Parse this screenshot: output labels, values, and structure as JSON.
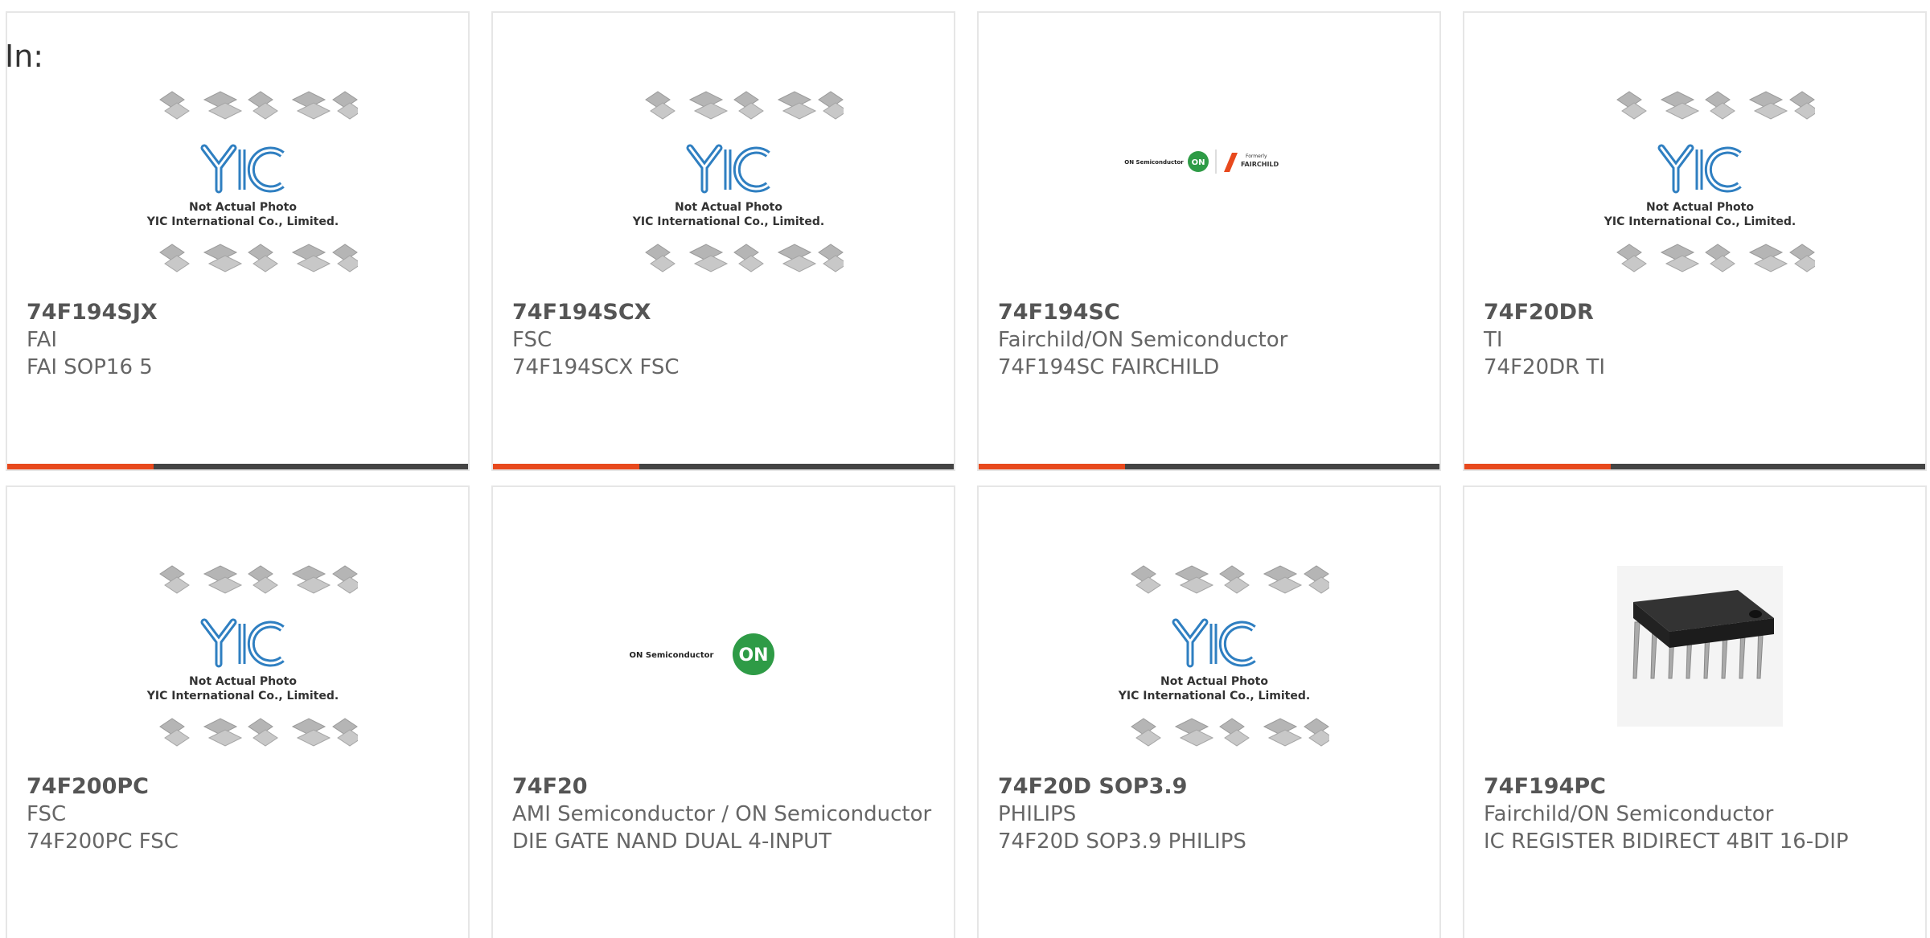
{
  "header": {
    "label": "In:"
  },
  "colors": {
    "accent": "#e8491d",
    "bar": "#444444",
    "border": "#e6e6e6",
    "yic_blue": "#2f7fc1",
    "on_green": "#2e9b46"
  },
  "placeholder": {
    "line1": "Not Actual Photo",
    "line2": "YIC International Co., Limited."
  },
  "logos": {
    "on_semi_text": "ON Semiconductor",
    "on_mark": "ON",
    "formerly": "Formerly",
    "fairchild": "FAIRCHILD"
  },
  "products": [
    {
      "part": "74F194SJX",
      "manufacturer": "FAI",
      "description": "FAI SOP16 5",
      "image": "yic-placeholder"
    },
    {
      "part": "74F194SCX",
      "manufacturer": "FSC",
      "description": "74F194SCX FSC",
      "image": "yic-placeholder"
    },
    {
      "part": "74F194SC",
      "manufacturer": "Fairchild/ON Semiconductor",
      "description": "74F194SC FAIRCHILD",
      "image": "onsemi-fairchild-logo"
    },
    {
      "part": "74F20DR",
      "manufacturer": "TI",
      "description": "74F20DR TI",
      "image": "yic-placeholder"
    },
    {
      "part": "74F200PC",
      "manufacturer": "FSC",
      "description": "74F200PC FSC",
      "image": "yic-placeholder"
    },
    {
      "part": "74F20",
      "manufacturer": "AMI Semiconductor / ON Semiconductor",
      "description": "DIE GATE NAND DUAL 4-INPUT",
      "image": "onsemi-logo"
    },
    {
      "part": "74F20D SOP3.9",
      "manufacturer": "PHILIPS",
      "description": "74F20D SOP3.9 PHILIPS",
      "image": "yic-placeholder"
    },
    {
      "part": "74F194PC",
      "manufacturer": "Fairchild/ON Semiconductor",
      "description": "IC REGISTER BIDIRECT 4BIT 16-DIP",
      "image": "dip16-chip-photo"
    }
  ]
}
